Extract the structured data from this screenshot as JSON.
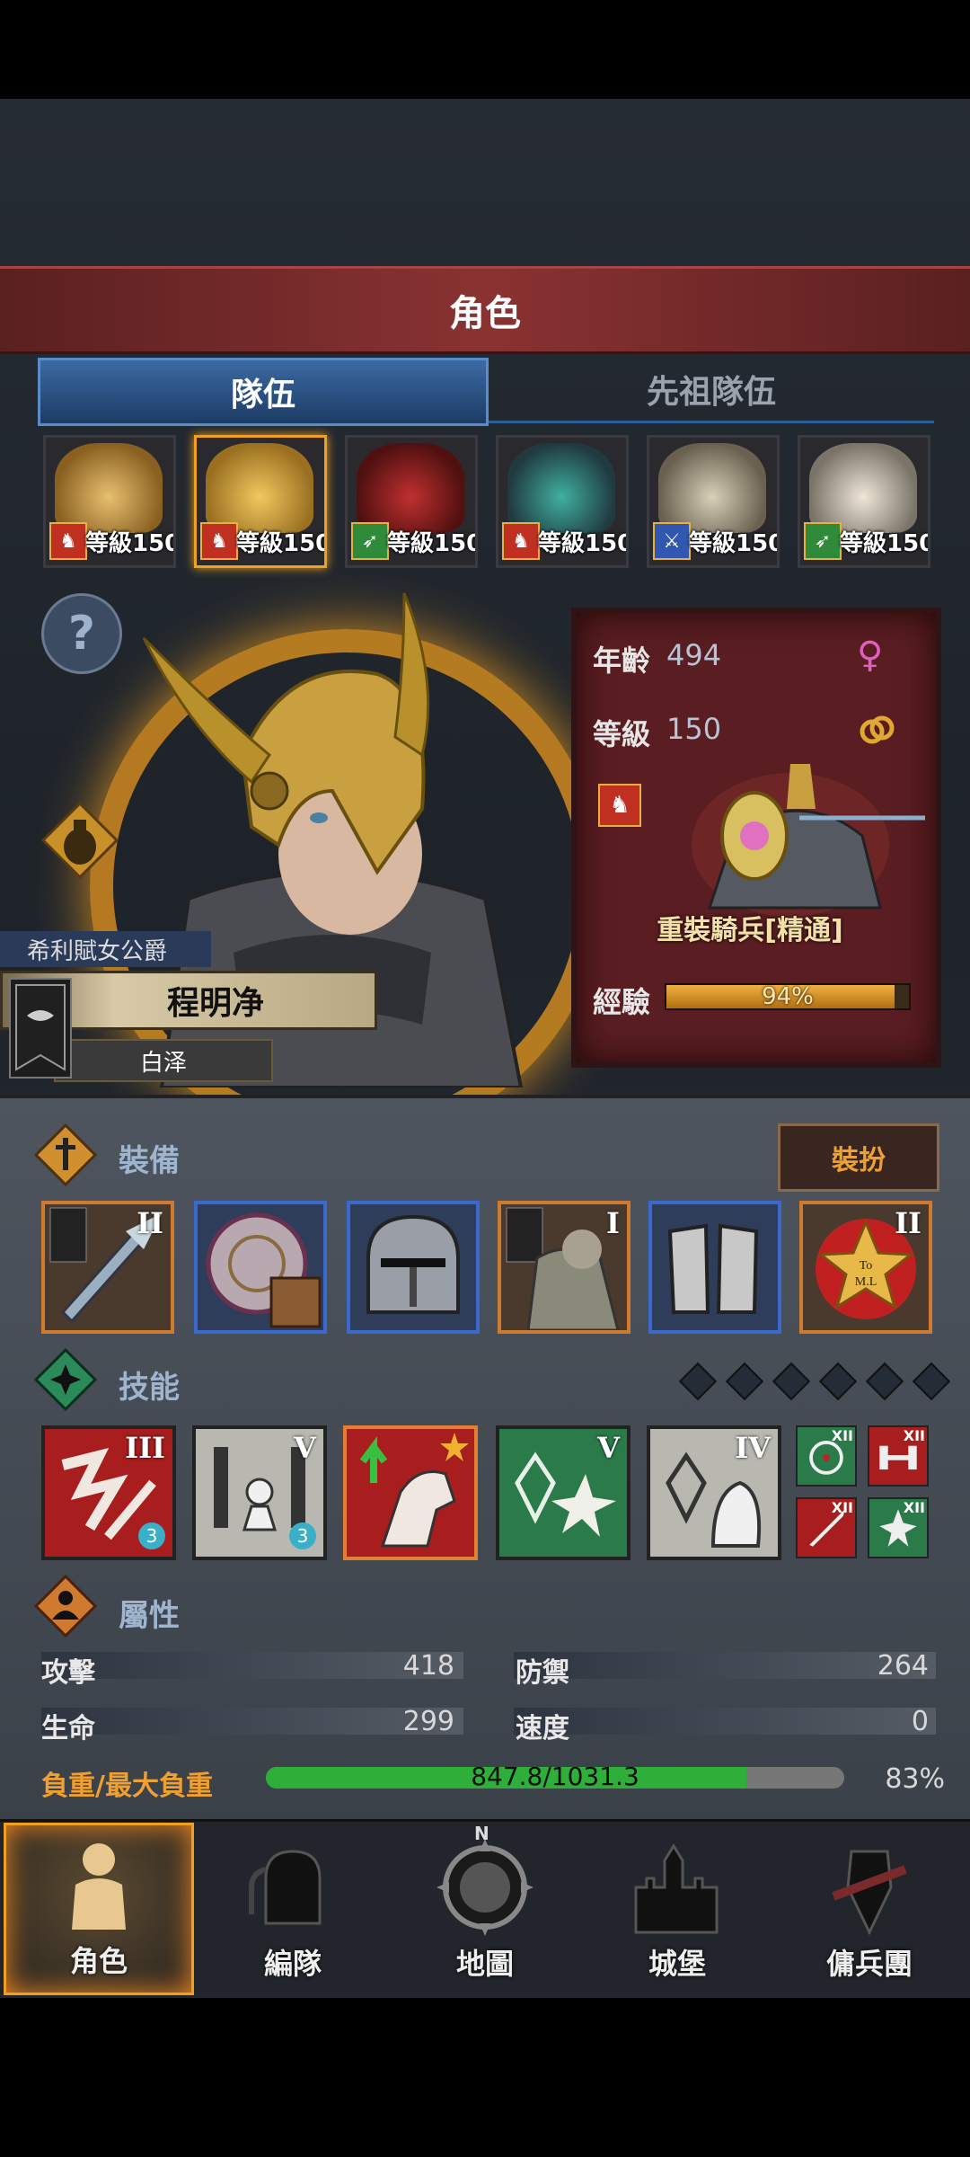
{
  "header": {
    "title": "角色"
  },
  "tabs": [
    {
      "label": "隊伍",
      "active": true
    },
    {
      "label": "先祖隊伍",
      "active": false
    }
  ],
  "roster": [
    {
      "class": "cavalry",
      "level_text": "等級150",
      "selected": false,
      "color": "#c8a040"
    },
    {
      "class": "cavalry",
      "level_text": "等級150",
      "selected": true,
      "color": "#c8a040"
    },
    {
      "class": "archer",
      "level_text": "等級150",
      "selected": false,
      "color": "#a02020"
    },
    {
      "class": "cavalry",
      "level_text": "等級150",
      "selected": false,
      "color": "#2a8a7a"
    },
    {
      "class": "swordsman",
      "level_text": "等級150",
      "selected": false,
      "color": "#b0a890"
    },
    {
      "class": "archer",
      "level_text": "等級150",
      "selected": false,
      "color": "#d8d0c0"
    }
  ],
  "hero": {
    "title": "希利賦女公爵",
    "name": "程明净",
    "subname": "白泽",
    "age_label": "年齡",
    "age": "494",
    "level_label": "等級",
    "level": "150",
    "gender_icon": "♀",
    "ring_icon": "ring-icon",
    "class_name": "重裝騎兵[精通]",
    "exp_label": "經驗",
    "exp_text": "94%",
    "exp_percent": 94
  },
  "equipment": {
    "title": "裝備",
    "dress_button": "裝扮",
    "slots": [
      {
        "name": "weapon",
        "rank": "II",
        "tier": "orange"
      },
      {
        "name": "shield",
        "rank": "",
        "tier": "blue"
      },
      {
        "name": "helmet",
        "rank": "",
        "tier": "blue"
      },
      {
        "name": "armor",
        "rank": "I",
        "tier": "orange"
      },
      {
        "name": "boots",
        "rank": "",
        "tier": "blue"
      },
      {
        "name": "medal",
        "rank": "II",
        "tier": "orange",
        "medal_text": "To M.L"
      }
    ]
  },
  "skills": {
    "title": "技能",
    "diamond_count": 6,
    "items": [
      {
        "name": "skill-strike",
        "rank": "III",
        "color": "red",
        "badge": "3"
      },
      {
        "name": "skill-guard",
        "rank": "V",
        "color": "gray",
        "badge": "3"
      },
      {
        "name": "skill-charge",
        "rank": "",
        "color": "red",
        "selected": true
      },
      {
        "name": "skill-burst",
        "rank": "V",
        "color": "green"
      },
      {
        "name": "skill-crystal",
        "rank": "IV",
        "color": "gray"
      }
    ],
    "mini": [
      {
        "name": "target",
        "rank": "XII",
        "color": "#2a7a4a"
      },
      {
        "name": "dumbbell",
        "rank": "XII",
        "color": "#a81e1e"
      },
      {
        "name": "sword",
        "rank": "XII",
        "color": "#a81e1e"
      },
      {
        "name": "burst",
        "rank": "XII",
        "color": "#2a7a4a"
      }
    ]
  },
  "attributes": {
    "title": "屬性",
    "attack_label": "攻擊",
    "attack": "418",
    "defense_label": "防禦",
    "defense": "264",
    "hp_label": "生命",
    "hp": "299",
    "speed_label": "速度",
    "speed": "0",
    "load_label": "負重/最大負重",
    "load_text": "847.8/1031.3",
    "load_percent_text": "83%",
    "load_fraction": 0.83
  },
  "nav": [
    {
      "label": "角色",
      "active": true
    },
    {
      "label": "編隊",
      "active": false
    },
    {
      "label": "地圖",
      "active": false,
      "compass_letter": "N"
    },
    {
      "label": "城堡",
      "active": false
    },
    {
      "label": "傭兵團",
      "active": false
    }
  ]
}
